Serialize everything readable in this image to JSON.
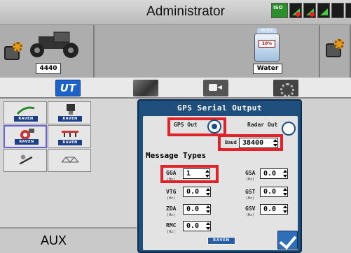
{
  "window": {
    "title": "Administrator",
    "iso_badge": "ISO"
  },
  "machines": {
    "tractor_label": "4440",
    "tank_cap": "WATER",
    "tank_percent": "10%",
    "tank_label": "Water"
  },
  "tabs": [
    {
      "id": "ut",
      "label": "UT",
      "active": true
    },
    {
      "id": "map",
      "label": "",
      "active": false
    },
    {
      "id": "camera",
      "label": "",
      "active": false
    },
    {
      "id": "settings",
      "label": "",
      "active": false
    }
  ],
  "apps": [
    {
      "name": "RAVEN",
      "icon": "guidance-line-icon"
    },
    {
      "name": "RAVEN",
      "icon": "spray-nozzle-icon"
    },
    {
      "name": "RAVEN",
      "icon": "gps-satellite-icon",
      "selected": true
    },
    {
      "name": "RAVEN",
      "icon": "boom-sprayer-icon"
    },
    {
      "name": "",
      "icon": "seed-scale-icon"
    },
    {
      "name": "",
      "icon": "bridge-icon"
    }
  ],
  "aux": {
    "label": "AUX"
  },
  "dialog": {
    "title": "GPS Serial Output",
    "gps_out_label": "GPS Out",
    "radar_out_label": "Radar Out",
    "baud_label": "Baud",
    "baud_value": "38400",
    "message_types_label": "Message Types",
    "hz_unit": "(Hz)",
    "messages": {
      "gga": {
        "label": "GGA",
        "value": "1"
      },
      "gsa": {
        "label": "GSA",
        "value": "0.0"
      },
      "vtg": {
        "label": "VTG",
        "value": "0.0"
      },
      "gst": {
        "label": "GST",
        "value": "0.0"
      },
      "zda": {
        "label": "ZDA",
        "value": "0.0"
      },
      "gsv": {
        "label": "GSV",
        "value": "0.0"
      },
      "rmc": {
        "label": "RMC",
        "value": "0.0"
      }
    },
    "brand": "RAVEN",
    "selected_output": "GPS Out"
  },
  "colors": {
    "highlight": "#e0232a",
    "dialog_blue": "#1f4f7d",
    "accent": "#1c62c8"
  }
}
